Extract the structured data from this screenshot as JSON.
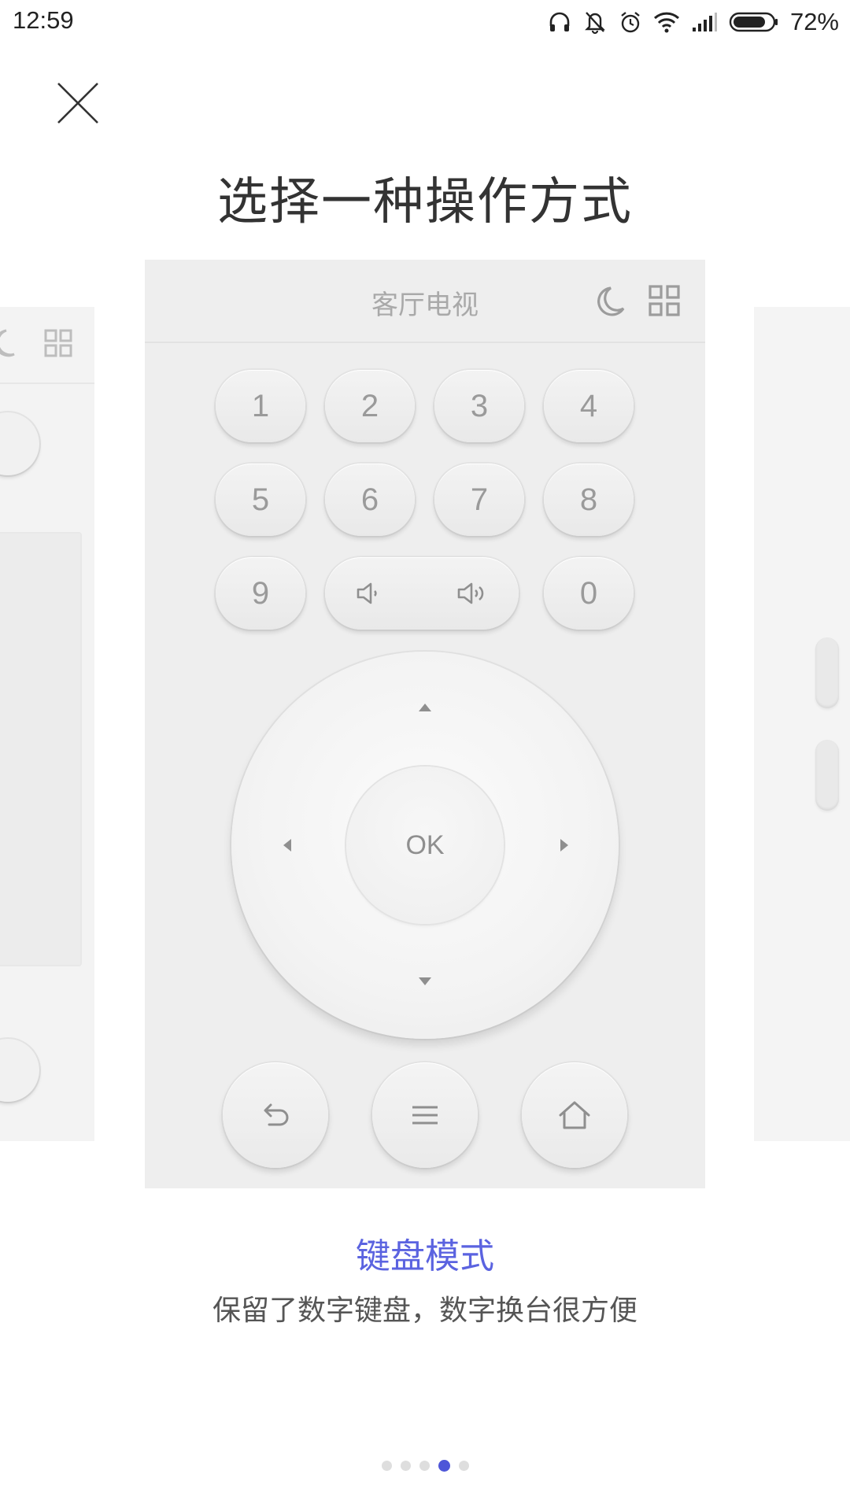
{
  "status_bar": {
    "time": "12:59",
    "battery_percent": "72%",
    "icons": [
      "headphones-icon",
      "vibrate-off-icon",
      "alarm-icon",
      "wifi-icon",
      "signal-icon",
      "battery-icon"
    ]
  },
  "page": {
    "title": "选择一种操作方式",
    "close_icon": "close-icon"
  },
  "remote": {
    "device_name": "客厅电视",
    "header_icons": [
      "moon-icon",
      "grid-icon"
    ],
    "number_keys": [
      "1",
      "2",
      "3",
      "4",
      "5",
      "6",
      "7",
      "8",
      "9",
      "0"
    ],
    "volume_icons": [
      "volume-down-icon",
      "volume-up-icon"
    ],
    "ok_label": "OK",
    "bottom_icons": [
      "back-icon",
      "menu-icon",
      "home-icon"
    ]
  },
  "mode": {
    "title": "键盘模式",
    "description": "保留了数字键盘，数字换台很方便"
  },
  "pager": {
    "count": 5,
    "active_index": 3
  },
  "colors": {
    "accent": "#5b63e0",
    "active_dot": "#4e56d8",
    "card_bg": "#eeeeee"
  }
}
